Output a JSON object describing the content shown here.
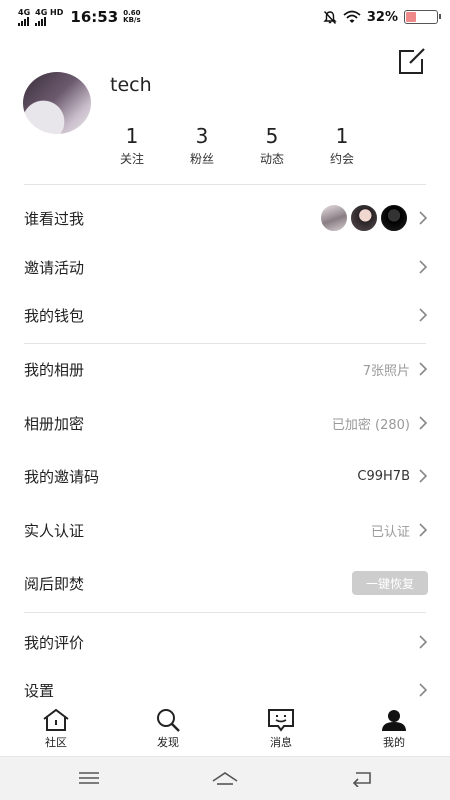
{
  "status_bar": {
    "net1": "4G",
    "net2": "4G HD",
    "time": "16:53",
    "speed_value": "0.60",
    "speed_unit": "KB/s",
    "battery_text": "32%",
    "battery_level": 0.32,
    "battery_color": "#f08a8a"
  },
  "profile": {
    "username": "tech",
    "stats": [
      {
        "num": "1",
        "label": "关注"
      },
      {
        "num": "3",
        "label": "粉丝"
      },
      {
        "num": "5",
        "label": "动态"
      },
      {
        "num": "1",
        "label": "约会"
      }
    ]
  },
  "menu": {
    "visitors": {
      "label": "谁看过我"
    },
    "invite_activity": {
      "label": "邀请活动"
    },
    "wallet": {
      "label": "我的钱包"
    },
    "album": {
      "label": "我的相册",
      "value": "7张照片"
    },
    "album_encrypt": {
      "label": "相册加密",
      "value": "已加密 (280)"
    },
    "invite_code": {
      "label": "我的邀请码",
      "value": "C99H7B"
    },
    "verification": {
      "label": "实人认证",
      "value": "已认证"
    },
    "burn_after_read": {
      "label": "阅后即焚",
      "button": "一键恢复"
    },
    "reviews": {
      "label": "我的评价"
    },
    "settings": {
      "label": "设置"
    }
  },
  "tabs": {
    "community": "社区",
    "discover": "发现",
    "messages": "消息",
    "mine": "我的"
  }
}
